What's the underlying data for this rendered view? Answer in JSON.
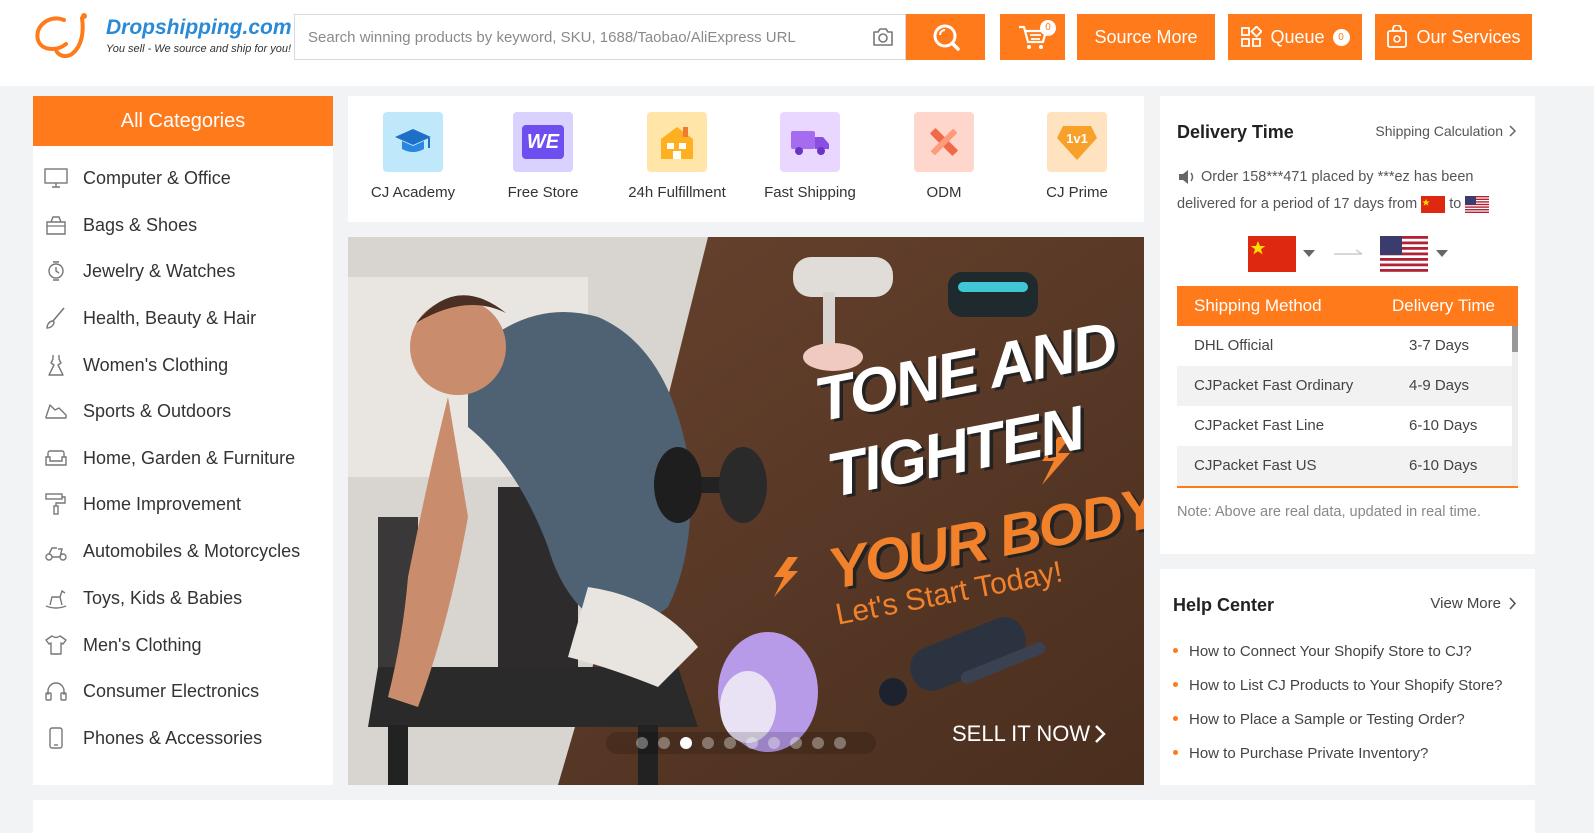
{
  "header": {
    "logo_name": "Dropshipping.com",
    "logo_slogan": "You sell - We source and ship for you!",
    "search_placeholder": "Search winning products by keyword, SKU, 1688/Taobao/AliExpress URL",
    "cart_count": "0",
    "source_more": "Source More",
    "queue_label": "Queue",
    "queue_count": "0",
    "our_services": "Our Services",
    "brand_color": "#ff7a1a"
  },
  "categories": {
    "title": "All Categories",
    "items": [
      {
        "label": "Computer & Office",
        "icon": "monitor-icon"
      },
      {
        "label": "Bags & Shoes",
        "icon": "bag-icon"
      },
      {
        "label": "Jewelry & Watches",
        "icon": "watch-icon"
      },
      {
        "label": "Health, Beauty & Hair",
        "icon": "brush-icon"
      },
      {
        "label": "Women's Clothing",
        "icon": "dress-icon"
      },
      {
        "label": "Sports & Outdoors",
        "icon": "shoe-icon"
      },
      {
        "label": "Home, Garden & Furniture",
        "icon": "sofa-icon"
      },
      {
        "label": "Home Improvement",
        "icon": "paint-roller-icon"
      },
      {
        "label": "Automobiles & Motorcycles",
        "icon": "scooter-icon"
      },
      {
        "label": "Toys, Kids & Babies",
        "icon": "rocking-horse-icon"
      },
      {
        "label": "Men's Clothing",
        "icon": "tshirt-icon"
      },
      {
        "label": "Consumer Electronics",
        "icon": "headphones-icon"
      },
      {
        "label": "Phones & Accessories",
        "icon": "phone-icon"
      }
    ]
  },
  "features": [
    {
      "label": "CJ Academy",
      "icon": "graduation-cap-icon",
      "color": "#3ab6ea"
    },
    {
      "label": "Free Store",
      "icon": "we-store-icon",
      "color": "#7b5cf0",
      "badge": "WE"
    },
    {
      "label": "24h Fulfillment",
      "icon": "warehouse-icon",
      "color": "#ffb020"
    },
    {
      "label": "Fast Shipping",
      "icon": "truck-icon",
      "color": "#a66cf0"
    },
    {
      "label": "ODM",
      "icon": "ruler-pencil-icon",
      "color": "#f06a4a"
    },
    {
      "label": "CJ Prime",
      "icon": "prime-badge-icon",
      "color": "#f7a02a",
      "badge": "1v1"
    }
  ],
  "banner": {
    "line1": "TONE AND",
    "line2": "TIGHTEN",
    "line3": "YOUR BODY",
    "tagline": "Let's Start Today!",
    "cta": "SELL IT NOW",
    "slide_count": 10,
    "active_slide": 3
  },
  "delivery": {
    "title": "Delivery Time",
    "calc_link": "Shipping Calculation",
    "ticker_text": "Order 158***471 placed by ***ez has been delivered for a period of 17 days from",
    "ticker_to": "to",
    "from_country": "china-flag",
    "to_country": "usa-flag",
    "columns": [
      "Shipping Method",
      "Delivery Time"
    ],
    "rows": [
      {
        "method": "DHL Official",
        "time": "3-7 Days"
      },
      {
        "method": "CJPacket Fast Ordinary",
        "time": "4-9 Days"
      },
      {
        "method": "CJPacket Fast Line",
        "time": "6-10 Days"
      },
      {
        "method": "CJPacket Fast US",
        "time": "6-10 Days"
      }
    ],
    "note": "Note: Above are real data, updated in real time."
  },
  "help": {
    "title": "Help Center",
    "more": "View More",
    "items": [
      "How to Connect Your Shopify Store to CJ?",
      "How to List CJ Products to Your Shopify Store?",
      "How to Place a Sample or Testing Order?",
      "How to Purchase Private Inventory?"
    ]
  }
}
